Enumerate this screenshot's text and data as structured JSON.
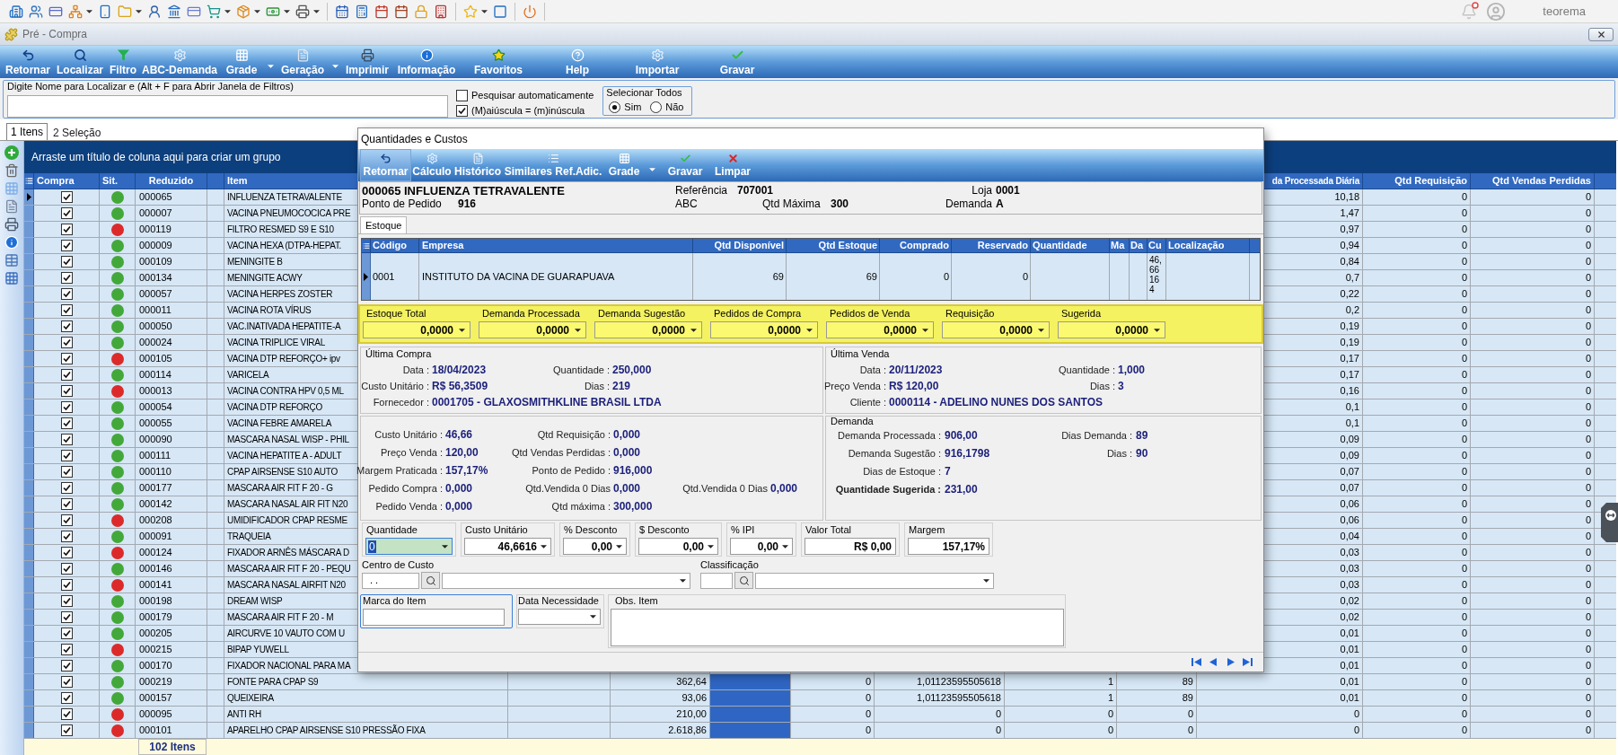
{
  "app_bar": {
    "user": "teorema"
  },
  "window": {
    "title": "Pré - Compra"
  },
  "ribbon": [
    {
      "label": "Retornar",
      "dropdown": false
    },
    {
      "label": "Localizar",
      "dropdown": false
    },
    {
      "label": "Filtro",
      "dropdown": false
    },
    {
      "label": "ABC-Demanda",
      "dropdown": false
    },
    {
      "label": "Grade",
      "dropdown": true
    },
    {
      "label": "Geração",
      "dropdown": true
    },
    {
      "label": "Imprimir",
      "dropdown": false
    },
    {
      "label": "Informação",
      "dropdown": false
    },
    {
      "label": "Favoritos",
      "dropdown": false
    },
    {
      "label": "Help",
      "dropdown": false
    },
    {
      "label": "Importar",
      "dropdown": false
    },
    {
      "label": "Gravar",
      "dropdown": false
    }
  ],
  "search": {
    "legend": "Digite Nome para Localizar e (Alt + F para Abrir Janela de Filtros)",
    "options": [
      {
        "label": "Pesquisar automaticamente",
        "checked": false
      },
      {
        "label": "(M)aiúscula = (m)inúscula",
        "checked": true
      }
    ],
    "select_all": {
      "legend": "Selecionar Todos",
      "options": [
        {
          "label": "Sim",
          "selected": true
        },
        {
          "label": "Não",
          "selected": false
        }
      ]
    }
  },
  "tabs": [
    {
      "label": "1 Itens",
      "selected": true
    },
    {
      "label": "2 Seleção",
      "selected": false
    }
  ],
  "grid": {
    "group_hint": "Arraste um título de coluna aqui para criar um grupo",
    "columns": {
      "compra": "Compra",
      "sit": "Sit.",
      "reduzido": "Reduzido",
      "item": "Item",
      "processada_diaria": "da Processada Diária",
      "qtd_requisicao": "Qtd Requisição",
      "qtd_vendas_perdidas": "Qtd Vendas Perdidas"
    },
    "rows": [
      {
        "selected": true,
        "checked": true,
        "color": "#43a83a",
        "reduzido": "000065",
        "item": "INFLUENZA TETRAVALENTE",
        "processada_diaria": "10,18",
        "qtd_requisicao": "0",
        "qtd_vendas_perdidas": "0"
      },
      {
        "selected": false,
        "checked": true,
        "color": "#43a83a",
        "reduzido": "000007",
        "item": "VACINA PNEUMOCOCICA PRE",
        "processada_diaria": "1,47",
        "qtd_requisicao": "0",
        "qtd_vendas_perdidas": "0"
      },
      {
        "selected": false,
        "checked": true,
        "color": "#dc2a2a",
        "reduzido": "000119",
        "item": "FILTRO RESMED S9 E S10",
        "processada_diaria": "0,97",
        "qtd_requisicao": "0",
        "qtd_vendas_perdidas": "0"
      },
      {
        "selected": false,
        "checked": true,
        "color": "#43a83a",
        "reduzido": "000009",
        "item": "VACINA HEXA (DTPA-HEPAT.",
        "processada_diaria": "0,94",
        "qtd_requisicao": "0",
        "qtd_vendas_perdidas": "0"
      },
      {
        "selected": false,
        "checked": true,
        "color": "#43a83a",
        "reduzido": "000109",
        "item": "MENINGITE B",
        "processada_diaria": "0,84",
        "qtd_requisicao": "0",
        "qtd_vendas_perdidas": "0"
      },
      {
        "selected": false,
        "checked": true,
        "color": "#43a83a",
        "reduzido": "000134",
        "item": "MENINGITE ACWY",
        "processada_diaria": "0,7",
        "qtd_requisicao": "0",
        "qtd_vendas_perdidas": "0"
      },
      {
        "selected": false,
        "checked": true,
        "color": "#43a83a",
        "reduzido": "000057",
        "item": "VACINA HERPES ZOSTER",
        "processada_diaria": "0,22",
        "qtd_requisicao": "0",
        "qtd_vendas_perdidas": "0"
      },
      {
        "selected": false,
        "checked": true,
        "color": "#43a83a",
        "reduzido": "000011",
        "item": "VACINA ROTA VÍRUS",
        "processada_diaria": "0,2",
        "qtd_requisicao": "0",
        "qtd_vendas_perdidas": "0"
      },
      {
        "selected": false,
        "checked": true,
        "color": "#43a83a",
        "reduzido": "000050",
        "item": "VAC.INATIVADA HEPATITE-A",
        "processada_diaria": "0,19",
        "qtd_requisicao": "0",
        "qtd_vendas_perdidas": "0"
      },
      {
        "selected": false,
        "checked": true,
        "color": "#43a83a",
        "reduzido": "000024",
        "item": "VACINA TRIPLICE VIRAL",
        "processada_diaria": "0,19",
        "qtd_requisicao": "0",
        "qtd_vendas_perdidas": "0"
      },
      {
        "selected": false,
        "checked": true,
        "color": "#dc2a2a",
        "reduzido": "000105",
        "item": "VACINA DTP REFORÇO+ ipv",
        "processada_diaria": "0,17",
        "qtd_requisicao": "0",
        "qtd_vendas_perdidas": "0"
      },
      {
        "selected": false,
        "checked": true,
        "color": "#43a83a",
        "reduzido": "000114",
        "item": "VARICELA",
        "processada_diaria": "0,17",
        "qtd_requisicao": "0",
        "qtd_vendas_perdidas": "0"
      },
      {
        "selected": false,
        "checked": true,
        "color": "#dc2a2a",
        "reduzido": "000013",
        "item": "VACINA CONTRA HPV 0,5 ML",
        "processada_diaria": "0,16",
        "qtd_requisicao": "0",
        "qtd_vendas_perdidas": "0"
      },
      {
        "selected": false,
        "checked": true,
        "color": "#43a83a",
        "reduzido": "000054",
        "item": "VACINA DTP REFORÇO",
        "processada_diaria": "0,1",
        "qtd_requisicao": "0",
        "qtd_vendas_perdidas": "0"
      },
      {
        "selected": false,
        "checked": true,
        "color": "#43a83a",
        "reduzido": "000055",
        "item": "VACINA FEBRE AMARELA",
        "processada_diaria": "0,1",
        "qtd_requisicao": "0",
        "qtd_vendas_perdidas": "0"
      },
      {
        "selected": false,
        "checked": true,
        "color": "#43a83a",
        "reduzido": "000090",
        "item": "MASCARA NASAL WISP - PHIL",
        "processada_diaria": "0,09",
        "qtd_requisicao": "0",
        "qtd_vendas_perdidas": "0"
      },
      {
        "selected": false,
        "checked": true,
        "color": "#43a83a",
        "reduzido": "000111",
        "item": "VACINA HEPATITE A - ADULT",
        "processada_diaria": "0,09",
        "qtd_requisicao": "0",
        "qtd_vendas_perdidas": "0"
      },
      {
        "selected": false,
        "checked": true,
        "color": "#43a83a",
        "reduzido": "000110",
        "item": "CPAP AIRSENSE S10 AUTO",
        "processada_diaria": "0,07",
        "qtd_requisicao": "0",
        "qtd_vendas_perdidas": "0"
      },
      {
        "selected": false,
        "checked": true,
        "color": "#43a83a",
        "reduzido": "000177",
        "item": "MASCARA AIR FIT F 20 - G",
        "processada_diaria": "0,07",
        "qtd_requisicao": "0",
        "qtd_vendas_perdidas": "0"
      },
      {
        "selected": false,
        "checked": true,
        "color": "#43a83a",
        "reduzido": "000142",
        "item": "MASCARA NASAL AIR FIT N20",
        "processada_diaria": "0,06",
        "qtd_requisicao": "0",
        "qtd_vendas_perdidas": "0"
      },
      {
        "selected": false,
        "checked": true,
        "color": "#dc2a2a",
        "reduzido": "000208",
        "item": "UMIDIFICADOR CPAP RESME",
        "processada_diaria": "0,06",
        "qtd_requisicao": "0",
        "qtd_vendas_perdidas": "0"
      },
      {
        "selected": false,
        "checked": true,
        "color": "#43a83a",
        "reduzido": "000091",
        "item": "TRAQUEIA",
        "processada_diaria": "0,04",
        "qtd_requisicao": "0",
        "qtd_vendas_perdidas": "0"
      },
      {
        "selected": false,
        "checked": true,
        "color": "#dc2a2a",
        "reduzido": "000124",
        "item": "FIXADOR ARNÊS MÁSCARA D",
        "processada_diaria": "0,03",
        "qtd_requisicao": "0",
        "qtd_vendas_perdidas": "0"
      },
      {
        "selected": false,
        "checked": true,
        "color": "#43a83a",
        "reduzido": "000146",
        "item": "MASCARA AIR FIT F 20 - PEQU",
        "processada_diaria": "0,03",
        "qtd_requisicao": "0",
        "qtd_vendas_perdidas": "0"
      },
      {
        "selected": false,
        "checked": true,
        "color": "#dc2a2a",
        "reduzido": "000141",
        "item": "MASCARA NASAL AIRFIT N20",
        "processada_diaria": "0,03",
        "qtd_requisicao": "0",
        "qtd_vendas_perdidas": "0"
      },
      {
        "selected": false,
        "checked": true,
        "color": "#43a83a",
        "reduzido": "000198",
        "item": "DREAM WISP",
        "processada_diaria": "0,02",
        "qtd_requisicao": "0",
        "qtd_vendas_perdidas": "0"
      },
      {
        "selected": false,
        "checked": true,
        "color": "#43a83a",
        "reduzido": "000179",
        "item": "MASCARA AIR FIT F 20 - M",
        "processada_diaria": "0,02",
        "qtd_requisicao": "0",
        "qtd_vendas_perdidas": "0"
      },
      {
        "selected": false,
        "checked": true,
        "color": "#43a83a",
        "reduzido": "000205",
        "item": "AIRCURVE 10 VAUTO COM U",
        "processada_diaria": "0,01",
        "qtd_requisicao": "0",
        "qtd_vendas_perdidas": "0"
      },
      {
        "selected": false,
        "checked": true,
        "color": "#dc2a2a",
        "reduzido": "000215",
        "item": "BIPAP YUWELL",
        "processada_diaria": "0,01",
        "qtd_requisicao": "0",
        "qtd_vendas_perdidas": "0"
      },
      {
        "selected": false,
        "checked": true,
        "color": "#43a83a",
        "reduzido": "000170",
        "item": "FIXADOR NACIONAL PARA MA",
        "processada_diaria": "0,01",
        "qtd_requisicao": "0",
        "qtd_vendas_perdidas": "0"
      },
      {
        "selected": false,
        "checked": true,
        "color": "#43a83a",
        "reduzido": "000219",
        "item": "FONTE PARA CPAP S9",
        "column_7": "362,64",
        "column_9": "0",
        "column_10": "1,01123595505618",
        "column_11": "1",
        "column_12": "89",
        "processada_diaria": "0,01",
        "qtd_requisicao": "0",
        "qtd_vendas_perdidas": "0"
      },
      {
        "selected": false,
        "checked": true,
        "color": "#43a83a",
        "reduzido": "000157",
        "item": "QUEIXEIRA",
        "column_7": "93,06",
        "column_9": "0",
        "column_10": "1,01123595505618",
        "column_11": "1",
        "column_12": "89",
        "processada_diaria": "0,01",
        "qtd_requisicao": "0",
        "qtd_vendas_perdidas": "0"
      },
      {
        "selected": false,
        "checked": true,
        "color": "#dc2a2a",
        "reduzido": "000095",
        "item": "ANTI RH",
        "column_7": "210,00",
        "column_9": "0",
        "column_10": "0",
        "column_11": "0",
        "column_12": "0",
        "processada_diaria": "0",
        "qtd_requisicao": "0",
        "qtd_vendas_perdidas": "0"
      },
      {
        "selected": false,
        "checked": true,
        "color": "#dc2a2a",
        "reduzido": "000101",
        "item": "APARELHO CPAP AIRSENSE S10 PRESSÃO FIXA",
        "column_7": "2.618,86",
        "column_9": "0",
        "column_10": "0",
        "column_11": "0",
        "column_12": "0",
        "processada_diaria": "0",
        "qtd_requisicao": "0",
        "qtd_vendas_perdidas": "0"
      }
    ],
    "footer": "102 Itens"
  },
  "dialog": {
    "title": "Quantidades e Custos",
    "toolbar": [
      {
        "label": "Retornar",
        "pressed": true,
        "dropdown": false
      },
      {
        "label": "Cálculo",
        "pressed": false,
        "dropdown": false
      },
      {
        "label": "Histórico",
        "pressed": false,
        "dropdown": false
      },
      {
        "label": "Similares Ref.Adic.",
        "pressed": false,
        "dropdown": false
      },
      {
        "label": "Grade",
        "pressed": false,
        "dropdown": true
      },
      {
        "label": "Gravar",
        "pressed": false,
        "dropdown": false
      },
      {
        "label": "Limpar",
        "pressed": false,
        "dropdown": false
      }
    ],
    "header": {
      "product": "000065 INFLUENZA TETRAVALENTE",
      "ponto_de_pedido": {
        "label": "Ponto de Pedido",
        "value": "916"
      },
      "referencia": {
        "label": "Referência",
        "value": "707001"
      },
      "abc": {
        "label": "ABC"
      },
      "qtd_maxima": {
        "label": "Qtd Máxima",
        "value": "300"
      },
      "loja": {
        "label": "Loja",
        "value": "0001"
      },
      "demanda": {
        "label": "Demanda",
        "value": "A"
      }
    },
    "tabs": [
      {
        "label": "Estoque",
        "selected": true
      }
    ],
    "stock": {
      "columns": [
        "Código",
        "Empresa",
        "Qtd Disponível",
        "Qtd Estoque",
        "Comprado",
        "Reservado",
        "Quantidade",
        "Ma",
        "Da",
        "Cu",
        "Localização"
      ],
      "rows": [
        {
          "selected": true,
          "codigo": "0001",
          "empresa": "INSTITUTO DA VACINA DE GUARAPUAVA",
          "qtd_disponivel": "69",
          "qtd_estoque": "69",
          "comprado": "0",
          "reservado": "0",
          "cu": "46,66164"
        }
      ]
    },
    "totals": [
      {
        "label": "Estoque Total",
        "value": "0,0000"
      },
      {
        "label": "Demanda Processada",
        "value": "0,0000"
      },
      {
        "label": "Demanda Sugestão",
        "value": "0,0000"
      },
      {
        "label": "Pedidos de Compra",
        "value": "0,0000"
      },
      {
        "label": "Pedidos de Venda",
        "value": "0,0000"
      },
      {
        "label": "Requisição",
        "value": "0,0000"
      },
      {
        "label": "Sugerida",
        "value": "0,0000"
      }
    ],
    "ultima_compra": {
      "legend": "Última Compra",
      "fields": [
        {
          "label": "Data :",
          "value": "18/04/2023"
        },
        {
          "label": "Quantidade :",
          "value": "250,000"
        },
        {
          "label": "Custo Unitário :",
          "value": "R$ 56,3509"
        },
        {
          "label": "Dias :",
          "value": "219"
        },
        {
          "label": "Fornecedor :",
          "value": "0001705 - GLAXOSMITHKLINE BRASIL LTDA"
        }
      ]
    },
    "ultima_venda": {
      "legend": "Última Venda",
      "fields": [
        {
          "label": "Data :",
          "value": "20/11/2023"
        },
        {
          "label": "Quantidade :",
          "value": "1,000"
        },
        {
          "label": "Preço Venda :",
          "value": "R$ 120,00"
        },
        {
          "label": "Dias :",
          "value": "3"
        },
        {
          "label": "Cliente :",
          "value": "0000114 - ADELINO NUNES DOS SANTOS"
        }
      ]
    },
    "custos": [
      {
        "fields": [
          {
            "label": "Custo Unitário :",
            "value": "46,66"
          },
          {
            "label": "Qtd Requisição :",
            "value": "0,000"
          }
        ]
      },
      {
        "fields": [
          {
            "label": "Preço Venda :",
            "value": "120,00"
          },
          {
            "label": "Qtd Vendas Perdidas :",
            "value": "0,000"
          }
        ]
      },
      {
        "fields": [
          {
            "label": "Margem Praticada :",
            "value": "157,17%"
          },
          {
            "label": "Ponto de Pedido :",
            "value": "916,000"
          }
        ]
      },
      {
        "fields": [
          {
            "label": "Pedido Compra :",
            "value": "0,000"
          },
          {
            "label": "Qtd.Vendida 0 Dias",
            "value": "0,000"
          },
          {
            "label": "Qtd.Vendida 0 Dias",
            "value": "0,000"
          }
        ]
      },
      {
        "fields": [
          {
            "label": "Pedido Venda :",
            "value": "0,000"
          },
          {
            "label": "Qtd máxima :",
            "value": "300,000"
          }
        ]
      }
    ],
    "demanda": {
      "legend": "Demanda",
      "rows": [
        {
          "fields": [
            {
              "label": "Demanda Processada :",
              "value": "906,00",
              "strong": false
            },
            {
              "label": "Dias Demanda :",
              "value": "89",
              "strong": false
            }
          ]
        },
        {
          "fields": [
            {
              "label": "Demanda Sugestão :",
              "value": "916,1798",
              "strong": false
            },
            {
              "label": "Dias :",
              "value": "90",
              "strong": false
            }
          ]
        },
        {
          "fields": [
            {
              "label": "Dias de Estoque :",
              "value": "7",
              "strong": false
            }
          ]
        },
        {
          "fields": [
            {
              "label": "Quantidade Sugerida :",
              "value": "231,00",
              "strong": true
            }
          ]
        }
      ]
    },
    "entry": [
      {
        "label": "Quantidade",
        "value": "0",
        "dropdown": true,
        "focused": true
      },
      {
        "label": "Custo Unitário",
        "value": "46,6616",
        "dropdown": true,
        "focused": false
      },
      {
        "label": "% Desconto",
        "value": "0,00",
        "dropdown": true,
        "focused": false
      },
      {
        "label": "$ Desconto",
        "value": "0,00",
        "dropdown": true,
        "focused": false
      },
      {
        "label": "% IPI",
        "value": "0,00",
        "dropdown": true,
        "focused": false
      },
      {
        "label": "Valor Total",
        "value": "R$ 0,00",
        "dropdown": false,
        "focused": false
      },
      {
        "label": "Margem",
        "value": "157,17%",
        "dropdown": false,
        "focused": false
      }
    ],
    "lookups": [
      {
        "label": "Centro de Custo",
        "code": ". ."
      },
      {
        "label": "Classificação"
      }
    ],
    "notes": [
      {
        "kind": "text",
        "label": "Marca do Item",
        "highlighted": true
      },
      {
        "kind": "date",
        "label": "Data Necessidade",
        "highlighted": false
      },
      {
        "kind": "memo",
        "label": "Obs. Item",
        "highlighted": false
      }
    ]
  }
}
